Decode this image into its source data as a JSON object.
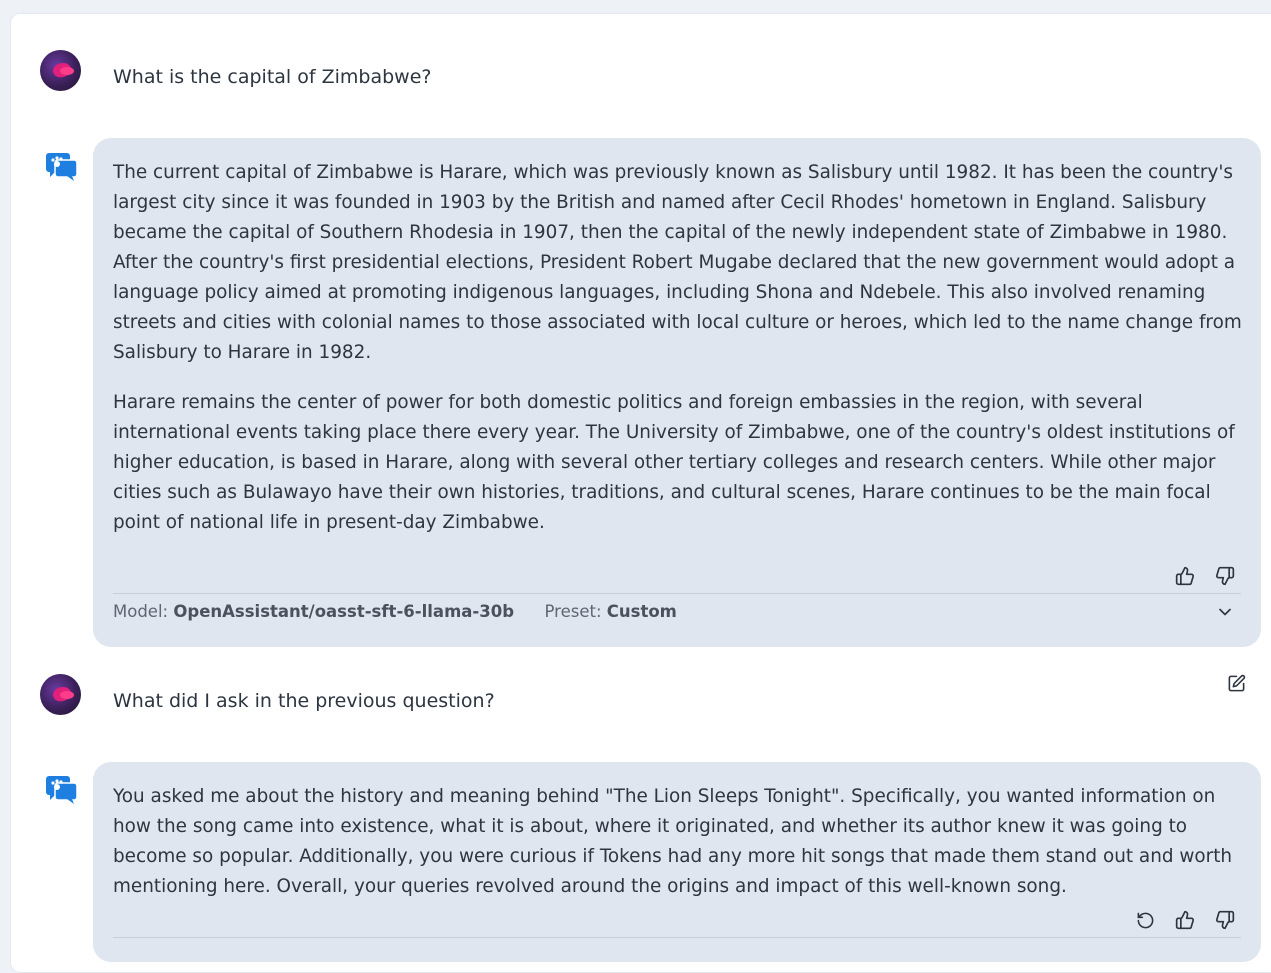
{
  "messages": [
    {
      "role": "user",
      "text": "What is the capital of Zimbabwe?"
    },
    {
      "role": "assistant",
      "paragraphs": [
        "The current capital of Zimbabwe is Harare, which was previously known as Salisbury until 1982. It has been the country's largest city since it was founded in 1903 by the British and named after Cecil Rhodes' hometown in England. Salisbury became the capital of Southern Rhodesia in 1907, then the capital of the newly independent state of Zimbabwe in 1980. After the country's first presidential elections, President Robert Mugabe declared that the new government would adopt a language policy aimed at promoting indigenous languages, including Shona and Ndebele. This also involved renaming streets and cities with colonial names to those associated with local culture or heroes, which led to the name change from Salisbury to Harare in 1982.",
        "Harare remains the center of power for both domestic politics and foreign embassies in the region, with several international events taking place there every year. The University of Zimbabwe, one of the country's oldest institutions of higher education, is based in Harare, along with several other tertiary colleges and research centers. While other major cities such as Bulawayo have their own histories, traditions, and cultural scenes, Harare continues to be the main focal point of national life in present-day Zimbabwe."
      ],
      "model_label": "Model:",
      "model_value": "OpenAssistant/oasst-sft-6-llama-30b",
      "preset_label": "Preset:",
      "preset_value": "Custom"
    },
    {
      "role": "user",
      "text": "What did I ask in the previous question?"
    },
    {
      "role": "assistant",
      "paragraphs": [
        "You asked me about the history and meaning behind \"The Lion Sleeps Tonight\". Specifically, you wanted information on how the song came into existence, what it is about, where it originated, and whether its author knew it was going to become so popular. Additionally, you were curious if Tokens had any more hit songs that made them stand out and worth mentioning here. Overall, your queries revolved around the origins and impact of this well-known song."
      ]
    }
  ],
  "icons": {
    "thumbs_up": "thumbs-up-icon",
    "thumbs_down": "thumbs-down-icon",
    "expand": "chevron-down-icon",
    "edit": "edit-icon",
    "retry": "retry-icon",
    "assistant": "assistant-chat-icon"
  },
  "colors": {
    "bubble_bg": "#dfe6ef",
    "page_bg": "#eef2f7",
    "assistant_icon": "#1f7fe0",
    "avatar_accent": "#e0207a"
  }
}
